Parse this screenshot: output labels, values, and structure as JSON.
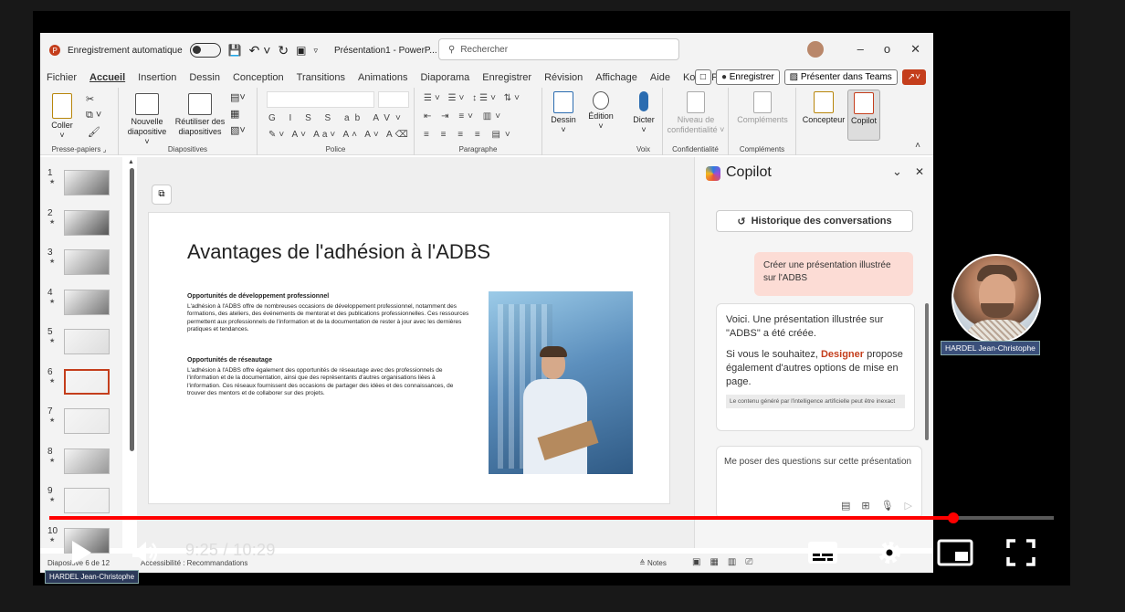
{
  "app": {
    "autosave_label": "Enregistrement automatique",
    "doc_title": "Présentation1 - PowerP...",
    "search_placeholder": "Rechercher",
    "minimize": "–",
    "restore": "ο",
    "close": "✕"
  },
  "tabs": [
    "Fichier",
    "Accueil",
    "Insertion",
    "Dessin",
    "Conception",
    "Transitions",
    "Animations",
    "Diaporama",
    "Enregistrer",
    "Révision",
    "Affichage",
    "Aide",
    "Kofax PDF"
  ],
  "tab_buttons": {
    "record": "Enregistrer",
    "present": "Présenter dans Teams"
  },
  "ribbon": {
    "paste": "Coller",
    "clipboard_group": "Presse-papiers",
    "new_slide": "Nouvelle diapositive ˅",
    "reuse": "Réutiliser des diapositives",
    "slides_group": "Diapositives",
    "font_group": "Police",
    "paragraph_group": "Paragraphe",
    "drawing": "Dessin",
    "editing": "Édition",
    "dictate": "Dicter",
    "voice_group": "Voix",
    "sensitivity": "Niveau de confidentialité ˅",
    "sensitivity_group": "Confidentialité",
    "addins": "Compléments",
    "addins_group": "Compléments",
    "designer": "Concepteur",
    "copilot": "Copilot"
  },
  "thumbnails": [
    {
      "num": "1"
    },
    {
      "num": "2"
    },
    {
      "num": "3"
    },
    {
      "num": "4"
    },
    {
      "num": "5"
    },
    {
      "num": "6"
    },
    {
      "num": "7"
    },
    {
      "num": "8"
    },
    {
      "num": "9"
    },
    {
      "num": "10"
    }
  ],
  "slide": {
    "title": "Avantages de l'adhésion à l'ADBS",
    "sections": [
      {
        "heading": "Opportunités de développement professionnel",
        "body": "L'adhésion à l'ADBS offre de nombreuses occasions de développement professionnel, notamment des formations, des ateliers, des événements de mentorat et des publications professionnelles. Ces ressources permettent aux professionnels de l'information et de la documentation de rester à jour avec les dernières pratiques et tendances."
      },
      {
        "heading": "Opportunités de réseautage",
        "body": "L'adhésion à l'ADBS offre également des opportunités de réseautage avec des professionnels de l'information et de la documentation, ainsi que des représentants d'autres organisations liées à l'information. Ces réseaux fournissent des occasions de partager des idées et des connaissances, de trouver des mentors et de collaborer sur des projets."
      }
    ]
  },
  "copilot": {
    "title": "Copilot",
    "history": "Historique des conversations",
    "user_msg": "Créer une présentation illustrée sur l'ADBS",
    "reply_1": "Voici. Une présentation illustrée sur \"ADBS\" a été créée.",
    "reply_2_pre": "Si vous le souhaitez,",
    "reply_2_link": "Designer",
    "reply_2_post": "propose également d'autres options de mise en page.",
    "disclaimer": "Le contenu généré par l'intelligence artificielle peut être inexact",
    "ask_placeholder": "Me poser des questions sur cette présentation"
  },
  "statusbar": {
    "slide_count": "Diapositive 6 de 12",
    "accessibility": "Accessibilité : Recommandations",
    "notes": "Notes"
  },
  "presenter": {
    "name": "HARDEL Jean-Christophe"
  },
  "player": {
    "time": "9:25 / 10:29",
    "progress_fraction": 0.9,
    "brand": "#ff0000"
  }
}
